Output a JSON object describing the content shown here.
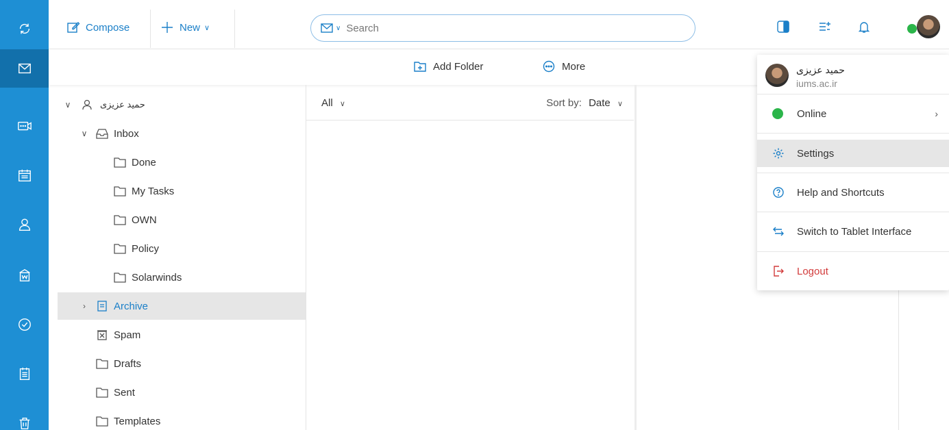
{
  "toolbar": {
    "compose_label": "Compose",
    "new_label": "New",
    "search_placeholder": "Search"
  },
  "subtoolbar": {
    "add_folder_label": "Add Folder",
    "more_label": "More"
  },
  "account": {
    "name": "حمید عزیزی",
    "domain": "iums.ac.ir"
  },
  "folders": [
    {
      "label": "Inbox",
      "icon": "inbox-icon"
    },
    {
      "label": "Done",
      "icon": "folder-icon"
    },
    {
      "label": "My Tasks",
      "icon": "folder-icon"
    },
    {
      "label": "OWN",
      "icon": "folder-icon"
    },
    {
      "label": "Policy",
      "icon": "folder-icon"
    },
    {
      "label": "Solarwinds",
      "icon": "folder-icon"
    },
    {
      "label": "Archive",
      "icon": "archive-icon",
      "selected": true
    },
    {
      "label": "Spam",
      "icon": "spam-icon"
    },
    {
      "label": "Drafts",
      "icon": "folder-icon"
    },
    {
      "label": "Sent",
      "icon": "folder-icon"
    },
    {
      "label": "Templates",
      "icon": "folder-icon"
    }
  ],
  "message_list": {
    "filter_label": "All",
    "sort_prefix": "Sort by:",
    "sort_value": "Date"
  },
  "user_menu": {
    "status_label": "Online",
    "settings_label": "Settings",
    "help_label": "Help and Shortcuts",
    "tablet_label": "Switch to Tablet Interface",
    "logout_label": "Logout"
  },
  "colors": {
    "rail": "#1e8fd4",
    "rail_active": "#1270ab",
    "accent": "#1a7fc8",
    "online": "#2bb54a",
    "logout": "#d23b3b",
    "selected_row": "#e6e6e6"
  },
  "rail_icons": [
    "refresh-icon",
    "mail-icon",
    "meeting-icon",
    "calendar-icon",
    "contacts-icon",
    "documents-icon",
    "tasks-icon",
    "notes-icon",
    "trash-icon"
  ]
}
